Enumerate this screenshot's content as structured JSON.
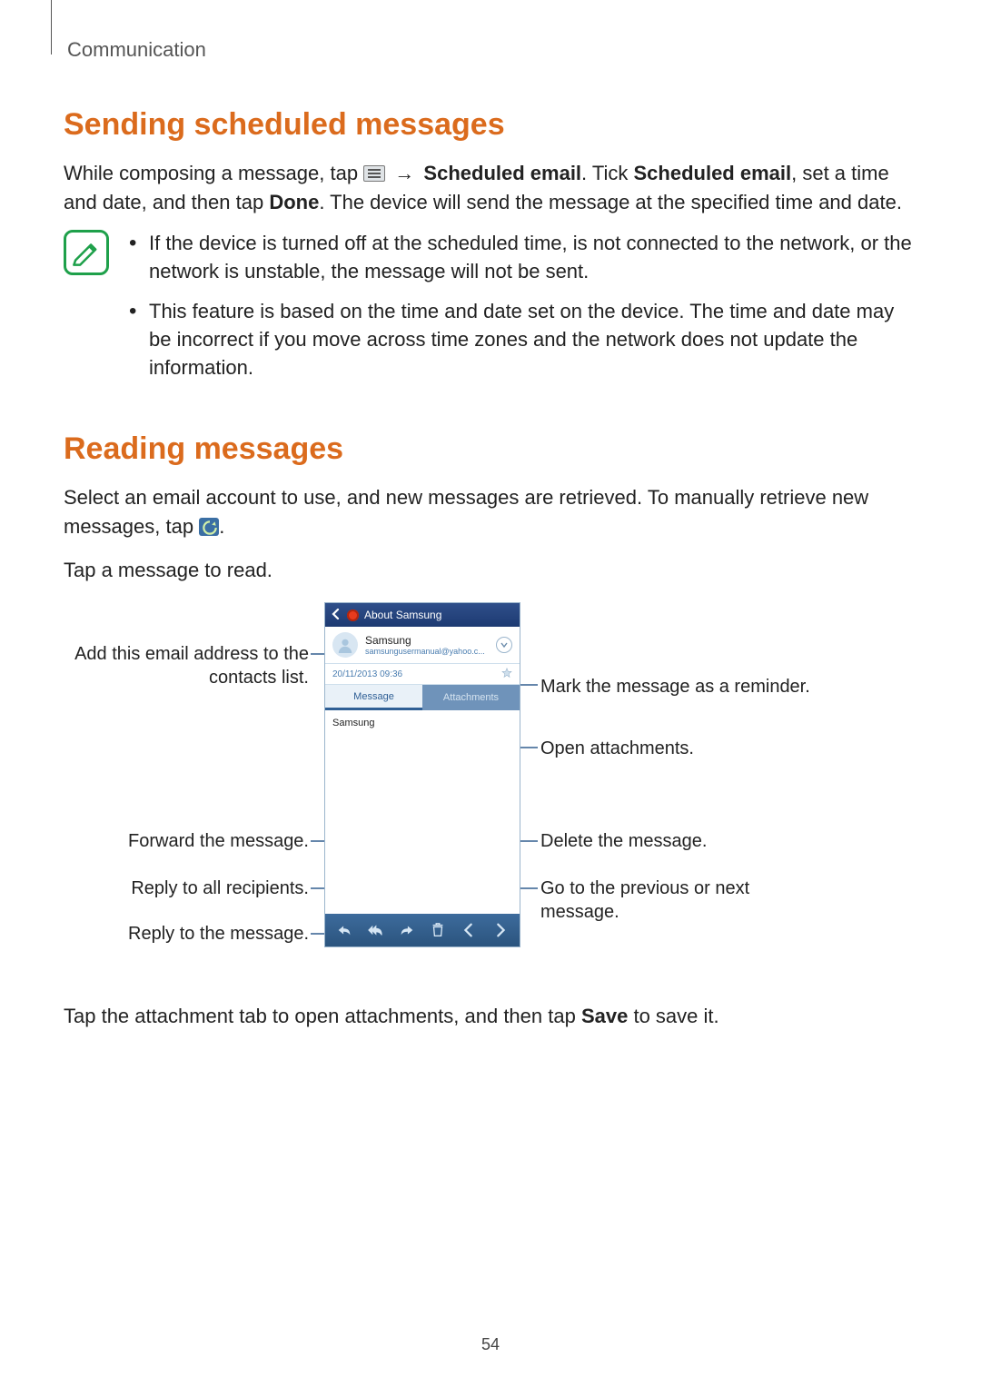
{
  "chapter": "Communication",
  "page_number": "54",
  "section1": {
    "heading": "Sending scheduled messages",
    "para_pre": "While composing a message, tap ",
    "arrow": "→",
    "bold_scheduled_email": "Scheduled email",
    "tick_txt": ". Tick ",
    "para_mid": ", set a time and date, and then tap ",
    "bold_done": "Done",
    "para_post": ". The device will send the message at the specified time and date.",
    "notes": [
      "If the device is turned off at the scheduled time, is not connected to the network, or the network is unstable, the message will not be sent.",
      "This feature is based on the time and date set on the device. The time and date may be incorrect if you move across time zones and the network does not update the information."
    ]
  },
  "section2": {
    "heading": "Reading messages",
    "para1_pre": "Select an email account to use, and new messages are retrieved. To manually retrieve new messages, tap ",
    "para1_post": ".",
    "para2": "Tap a message to read.",
    "attachment_para_pre": "Tap the attachment tab to open attachments, and then tap ",
    "bold_save": "Save",
    "attachment_para_post": " to save it."
  },
  "phone": {
    "title": "About Samsung",
    "sender_name": "Samsung",
    "sender_email": "samsungusermanual@yahoo.c...",
    "date": "20/11/2013 09:36",
    "tab_message": "Message",
    "tab_attachments": "Attachments",
    "body_text": "Samsung"
  },
  "callouts": {
    "add_contact": "Add this email address to the contacts list.",
    "forward": "Forward the message.",
    "reply_all": "Reply to all recipients.",
    "reply": "Reply to the message.",
    "reminder": "Mark the message as a reminder.",
    "open_attachments": "Open attachments.",
    "delete": "Delete the message.",
    "prev_next": "Go to the previous or next message."
  }
}
